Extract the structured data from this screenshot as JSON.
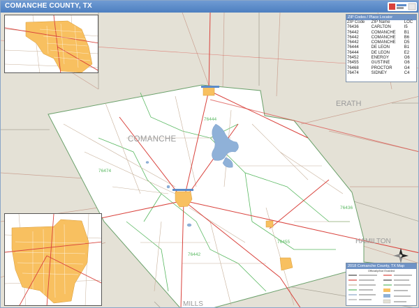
{
  "title": "COMANCHE COUNTY, TX",
  "map_labels": {
    "comanche_county": "COMANCHE",
    "erath": "ERATH",
    "hamilton": "HAMILTON",
    "mills": "MILLS"
  },
  "zip_area_labels": [
    {
      "text": "76444"
    },
    {
      "text": "76474"
    },
    {
      "text": "76436"
    },
    {
      "text": "76455"
    },
    {
      "text": "76442"
    }
  ],
  "zip_table": {
    "heading": "ZIP Codes / Place Locator",
    "columns": [
      "ZIP Code",
      "ZIP Name",
      "LOC"
    ],
    "rows": [
      [
        "76436",
        "CARLTON",
        "I5"
      ],
      [
        "76442",
        "COMANCHE",
        "B1"
      ],
      [
        "76442",
        "COMANCHE",
        "B6"
      ],
      [
        "76442",
        "COMANCHE",
        "D5"
      ],
      [
        "76444",
        "DE LEON",
        "B1"
      ],
      [
        "76444",
        "DE LEON",
        "E2"
      ],
      [
        "76452",
        "ENERGY",
        "G6"
      ],
      [
        "76455",
        "GUSTINE",
        "G6"
      ],
      [
        "76468",
        "PROCTOR",
        "G4"
      ],
      [
        "76474",
        "SIDNEY",
        "C4"
      ]
    ]
  },
  "legend": {
    "heading": "2018 Comanche County, TX Map",
    "subtitle": "Officially/Not Enabled"
  },
  "colors": {
    "title_bar": "#5b8bc9",
    "county_fill": "#ffffff",
    "outside_fill": "#e4e1d6",
    "city_fill": "#f8c060",
    "water": "#8fb1d8",
    "highway": "#d9423c",
    "road": "#b8a08c",
    "zip_boundary": "#3cb34a"
  },
  "icons": {
    "compass": "north-arrow-icon",
    "brand": "brand-logo"
  }
}
